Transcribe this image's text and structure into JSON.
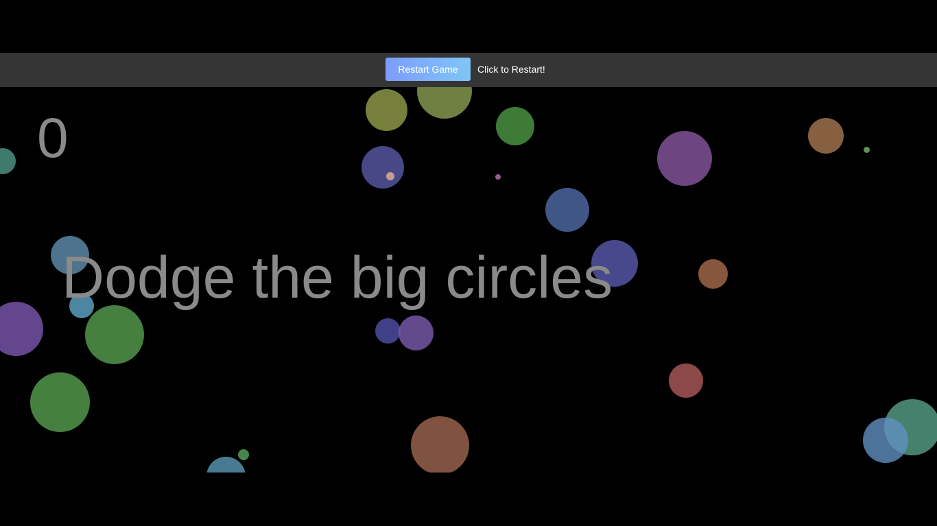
{
  "toolbar": {
    "restart_label": "Restart Game",
    "hint": "Click to Restart!"
  },
  "hud": {
    "score": "0",
    "instruction": "Dodge the big circles"
  },
  "colors": {
    "background": "#000000",
    "toolbar": "#353535",
    "button_gradient_start": "#7d9cff",
    "button_gradient_end": "#7fc6f5",
    "text_dim": "#8a8a8a"
  },
  "balls": [
    {
      "color": "#93a04a"
    },
    {
      "color": "#8ba052"
    },
    {
      "color": "#4e9a45"
    },
    {
      "color": "#5a5aa8"
    },
    {
      "color": "#e0b890"
    },
    {
      "color": "#c070b0"
    },
    {
      "color": "#4f6ba8"
    },
    {
      "color": "#8856a0"
    },
    {
      "color": "#a87850"
    },
    {
      "color": "#78b868"
    },
    {
      "color": "#6090b0"
    },
    {
      "color": "#5a5ab0"
    },
    {
      "color": "#a86c4c"
    },
    {
      "color": "#60a8c8"
    },
    {
      "color": "#7c58b0"
    },
    {
      "color": "#58a050"
    },
    {
      "color": "#5050a8"
    },
    {
      "color": "#7c5cb0"
    },
    {
      "color": "#b05a5a"
    },
    {
      "color": "#58a050"
    },
    {
      "color": "#a06850"
    },
    {
      "color": "#5aa08a"
    },
    {
      "color": "#6090c0"
    },
    {
      "color": "#4f9a88"
    },
    {
      "color": "#5a9ab8"
    },
    {
      "color": "#58a858"
    }
  ]
}
